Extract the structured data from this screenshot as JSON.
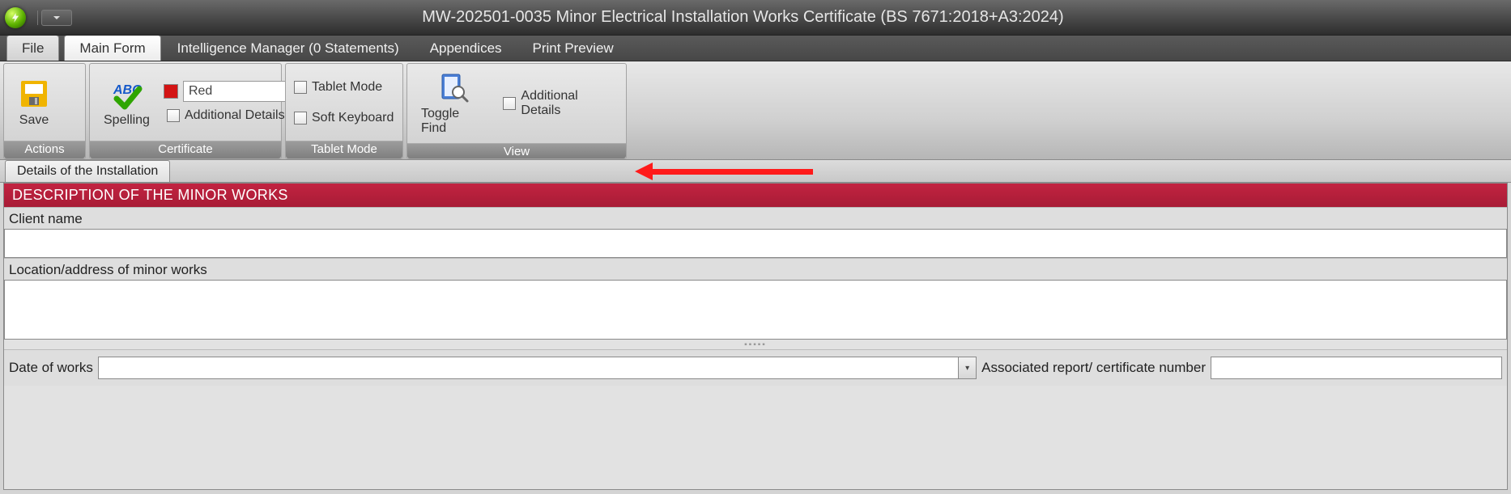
{
  "title": "MW-202501-0035 Minor Electrical Installation Works Certificate (BS 7671:2018+A3:2024)",
  "tabs": {
    "file": "File",
    "main_form": "Main Form",
    "intel_mgr": "Intelligence Manager (0 Statements)",
    "appendices": "Appendices",
    "print_preview": "Print Preview"
  },
  "ribbon": {
    "actions": {
      "title": "Actions",
      "save": "Save",
      "spelling": "Spelling"
    },
    "certificate": {
      "title": "Certificate",
      "color_name": "Red",
      "additional_details": "Additional Details"
    },
    "tablet_mode": {
      "title": "Tablet Mode",
      "tablet_mode": "Tablet Mode",
      "soft_keyboard": "Soft Keyboard"
    },
    "view": {
      "title": "View",
      "toggle_find": "Toggle Find",
      "additional_details": "Additional Details"
    }
  },
  "subtab": "Details of the Installation",
  "form": {
    "section_header": "DESCRIPTION OF THE MINOR WORKS",
    "client_name_label": "Client name",
    "client_name_value": "",
    "location_label": "Location/address of minor works",
    "location_value": "",
    "date_label": "Date of works",
    "date_value": "",
    "assoc_label": "Associated report/ certificate number",
    "assoc_value": ""
  }
}
